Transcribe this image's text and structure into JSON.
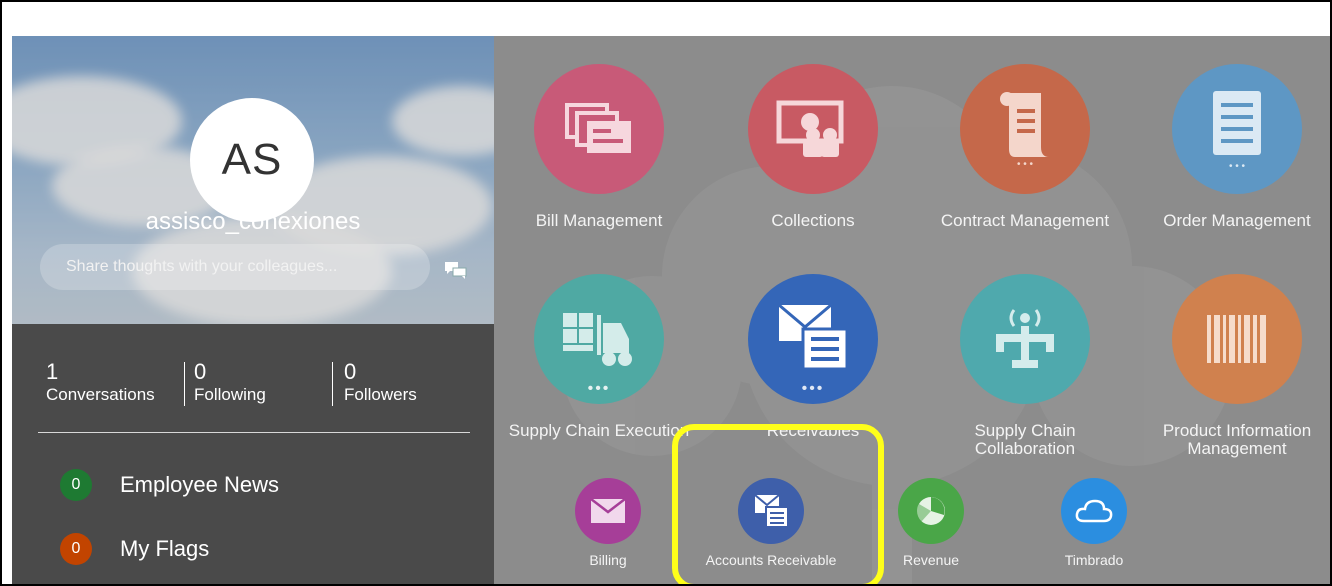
{
  "profile": {
    "avatar_initials": "AS",
    "username": "assisco_conexiones",
    "share_placeholder": "Share thoughts with your colleagues...",
    "stats": [
      {
        "count": "1",
        "label": "Conversations"
      },
      {
        "count": "0",
        "label": "Following"
      },
      {
        "count": "0",
        "label": "Followers"
      }
    ],
    "feeds": [
      {
        "count": "0",
        "label": "Employee News",
        "color": "#1e7a32"
      },
      {
        "count": "0",
        "label": "My Flags",
        "color": "#c24400"
      }
    ]
  },
  "apps": {
    "row1": [
      {
        "label": "Bill Management",
        "color": "#c85a78",
        "icon": "invoice-stack-icon"
      },
      {
        "label": "Collections",
        "color": "#c85a63",
        "icon": "money-people-icon"
      },
      {
        "label": "Contract Management",
        "color": "#c5684a",
        "icon": "scroll-document-icon"
      },
      {
        "label": "Order Management",
        "color": "#5e97c4",
        "icon": "document-list-icon"
      }
    ],
    "row2": [
      {
        "label": "Supply Chain Execution",
        "color": "#4fa9a3",
        "icon": "forklift-icon"
      },
      {
        "label": "Receivables",
        "color": "#3466b8",
        "icon": "envelope-document-icon"
      },
      {
        "label": "Supply Chain Collaboration",
        "color": "#4fa9ad",
        "icon": "signal-tower-icon"
      },
      {
        "label": "Product Information Management",
        "color": "#d0814e",
        "icon": "barcode-icon"
      }
    ],
    "row2_dots": "•••",
    "quick": [
      {
        "label": "Billing",
        "color": "#a63e98",
        "icon": "envelope-icon"
      },
      {
        "label": "Accounts Receivable",
        "color": "#3e5faa",
        "icon": "envelope-document-icon"
      },
      {
        "label": "Revenue",
        "color": "#4aa648",
        "icon": "pie-chart-icon"
      },
      {
        "label": "Timbrado",
        "color": "#2b8ee0",
        "icon": "cloud-icon"
      }
    ]
  }
}
